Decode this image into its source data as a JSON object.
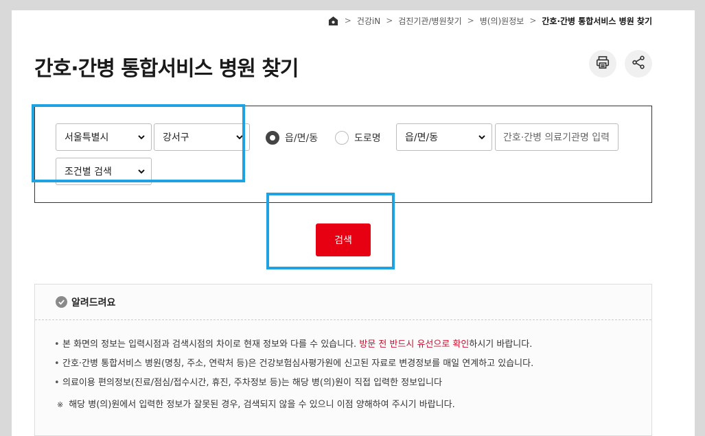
{
  "breadcrumb": {
    "items": [
      "건강iN",
      "검진기관/병원찾기",
      "병(의)원정보"
    ],
    "current": "간호·간병 통합서비스 병원 찾기",
    "separator": ">"
  },
  "page": {
    "title": "간호·간병 통합서비스 병원 찾기"
  },
  "toolbar": {
    "print_icon": "printer-icon",
    "share_icon": "share-icon"
  },
  "search": {
    "city_selected": "서울특별시",
    "gu_selected": "강서구",
    "condition_selected": "조건별 검색",
    "radio_eup_label": "읍/면/동",
    "radio_road_label": "도로명",
    "dong_selected": "읍/면/동",
    "name_placeholder": "간호·간병 의료기관명 입력",
    "search_button": "검색"
  },
  "notice": {
    "title": "알려드려요",
    "items": [
      {
        "text_before": "본 화면의 정보는 입력시점과 검색시점의 차이로 현재 정보와 다를 수 있습니다. ",
        "text_red": "방문 전 반드시 유선으로 확인",
        "text_after": "하시기 바랍니다."
      },
      {
        "text": "간호·간병 통합서비스 병원(명칭, 주소, 연락처 등)은 건강보험심사평가원에 신고된 자료로 변경정보를 매일 연계하고 있습니다."
      },
      {
        "text": "의료이용 편의정보(진료/점심/접수시간, 휴진, 주차정보 등)는 해당 병(의)원이 직접 입력한 정보입니다"
      }
    ],
    "note_mark": "※",
    "note": "해당 병(의)원에서 입력한 정보가 잘못된 경우, 검색되지 않을 수 있으니 이점 양해하여 주시기 바랍니다."
  },
  "colors": {
    "accent_red": "#e60012",
    "highlight_blue": "#1ea3e0",
    "notice_red": "#c8102e"
  }
}
